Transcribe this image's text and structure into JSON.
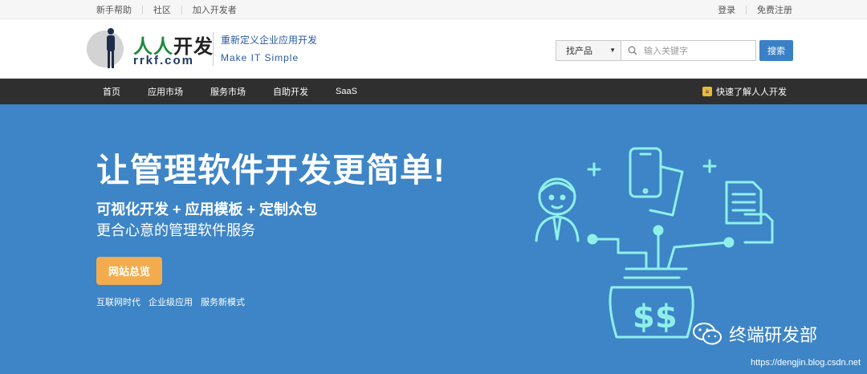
{
  "topbar": {
    "links": [
      "新手帮助",
      "社区",
      "加入开发者"
    ],
    "login": "登录",
    "register": "免费注册"
  },
  "header": {
    "brand_green": "人人",
    "brand_black": "开发",
    "domain": "rrkf.com",
    "slogan_cn": "重新定义企业应用开发",
    "slogan_en": "Make  IT  Simple"
  },
  "search": {
    "category": "找产品",
    "placeholder": "输入关键字",
    "button": "搜索"
  },
  "nav": {
    "items": [
      "首页",
      "应用市场",
      "服务市场",
      "自助开发",
      "SaaS"
    ],
    "quick": "快速了解人人开发"
  },
  "hero": {
    "title": "让管理软件开发更简单!",
    "subtitle": "可视化开发 + 应用模板 + 定制众包",
    "tagline": "更合心意的管理软件服务",
    "cta": "网站总览",
    "tags": [
      "互联网时代",
      "企业级应用",
      "服务新模式"
    ]
  },
  "watermark": {
    "text": "终端研发部",
    "url": "https://dengjin.blog.csdn.net"
  },
  "colors": {
    "hero_bg": "#3d85c6",
    "nav_bg": "#2f2f2f",
    "cta": "#f2ac4e",
    "brand_green": "#1f8a3b",
    "search_btn": "#3a80c7"
  }
}
